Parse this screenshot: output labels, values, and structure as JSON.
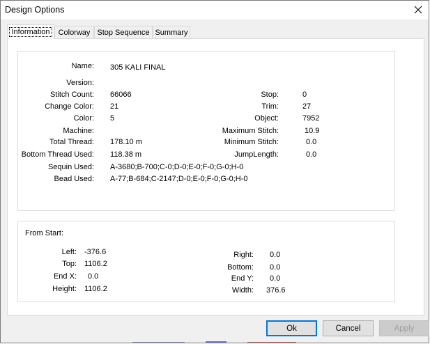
{
  "window": {
    "title": "Design Options"
  },
  "tabs": [
    "Information",
    "Colorway",
    "Stop Sequence",
    "Summary"
  ],
  "info": {
    "left_col": [
      {
        "label": "Name:",
        "value": "305 KALI FINAL"
      },
      {
        "label": "Version:",
        "value": ""
      },
      {
        "label": "Stitch Count:",
        "value": "66066"
      },
      {
        "label": "Change Color:",
        "value": "21"
      },
      {
        "label": "Color:",
        "value": "5"
      },
      {
        "label": "Machine:",
        "value": ""
      },
      {
        "label": "Total Thread:",
        "value": "178.10 m"
      },
      {
        "label": "Bottom Thread Used:",
        "value": "118.38 m"
      },
      {
        "label": "Sequin Used:",
        "value": "A-3680;B-700;C-0;D-0;E-0;F-0;G-0;H-0"
      },
      {
        "label": "Bead Used:",
        "value": "A-77;B-684;C-2147;D-0;E-0;F-0;G-0;H-0"
      }
    ],
    "right_col": [
      {
        "label": "Stop:",
        "value": "0"
      },
      {
        "label": "Trim:",
        "value": "27"
      },
      {
        "label": "Object:",
        "value": "7952"
      },
      {
        "label": "Maximum Stitch:",
        "value": "10.9"
      },
      {
        "label": "Minimum Stitch:",
        "value": "0.0"
      },
      {
        "label": "JumpLength:",
        "value": "0.0"
      }
    ]
  },
  "from_start": {
    "heading": "From Start:",
    "left_col": [
      {
        "label": "Left:",
        "value": "-376.6"
      },
      {
        "label": "Top:",
        "value": "1106.2"
      },
      {
        "label": "End X:",
        "value": "0.0"
      },
      {
        "label": "Height:",
        "value": "1106.2"
      }
    ],
    "right_col": [
      {
        "label": "Right:",
        "value": "0.0"
      },
      {
        "label": "Bottom:",
        "value": "0.0"
      },
      {
        "label": "End Y:",
        "value": "0.0"
      },
      {
        "label": "Width:",
        "value": "376.6"
      }
    ]
  },
  "buttons": {
    "ok": "Ok",
    "cancel": "Cancel",
    "apply": "Apply"
  }
}
